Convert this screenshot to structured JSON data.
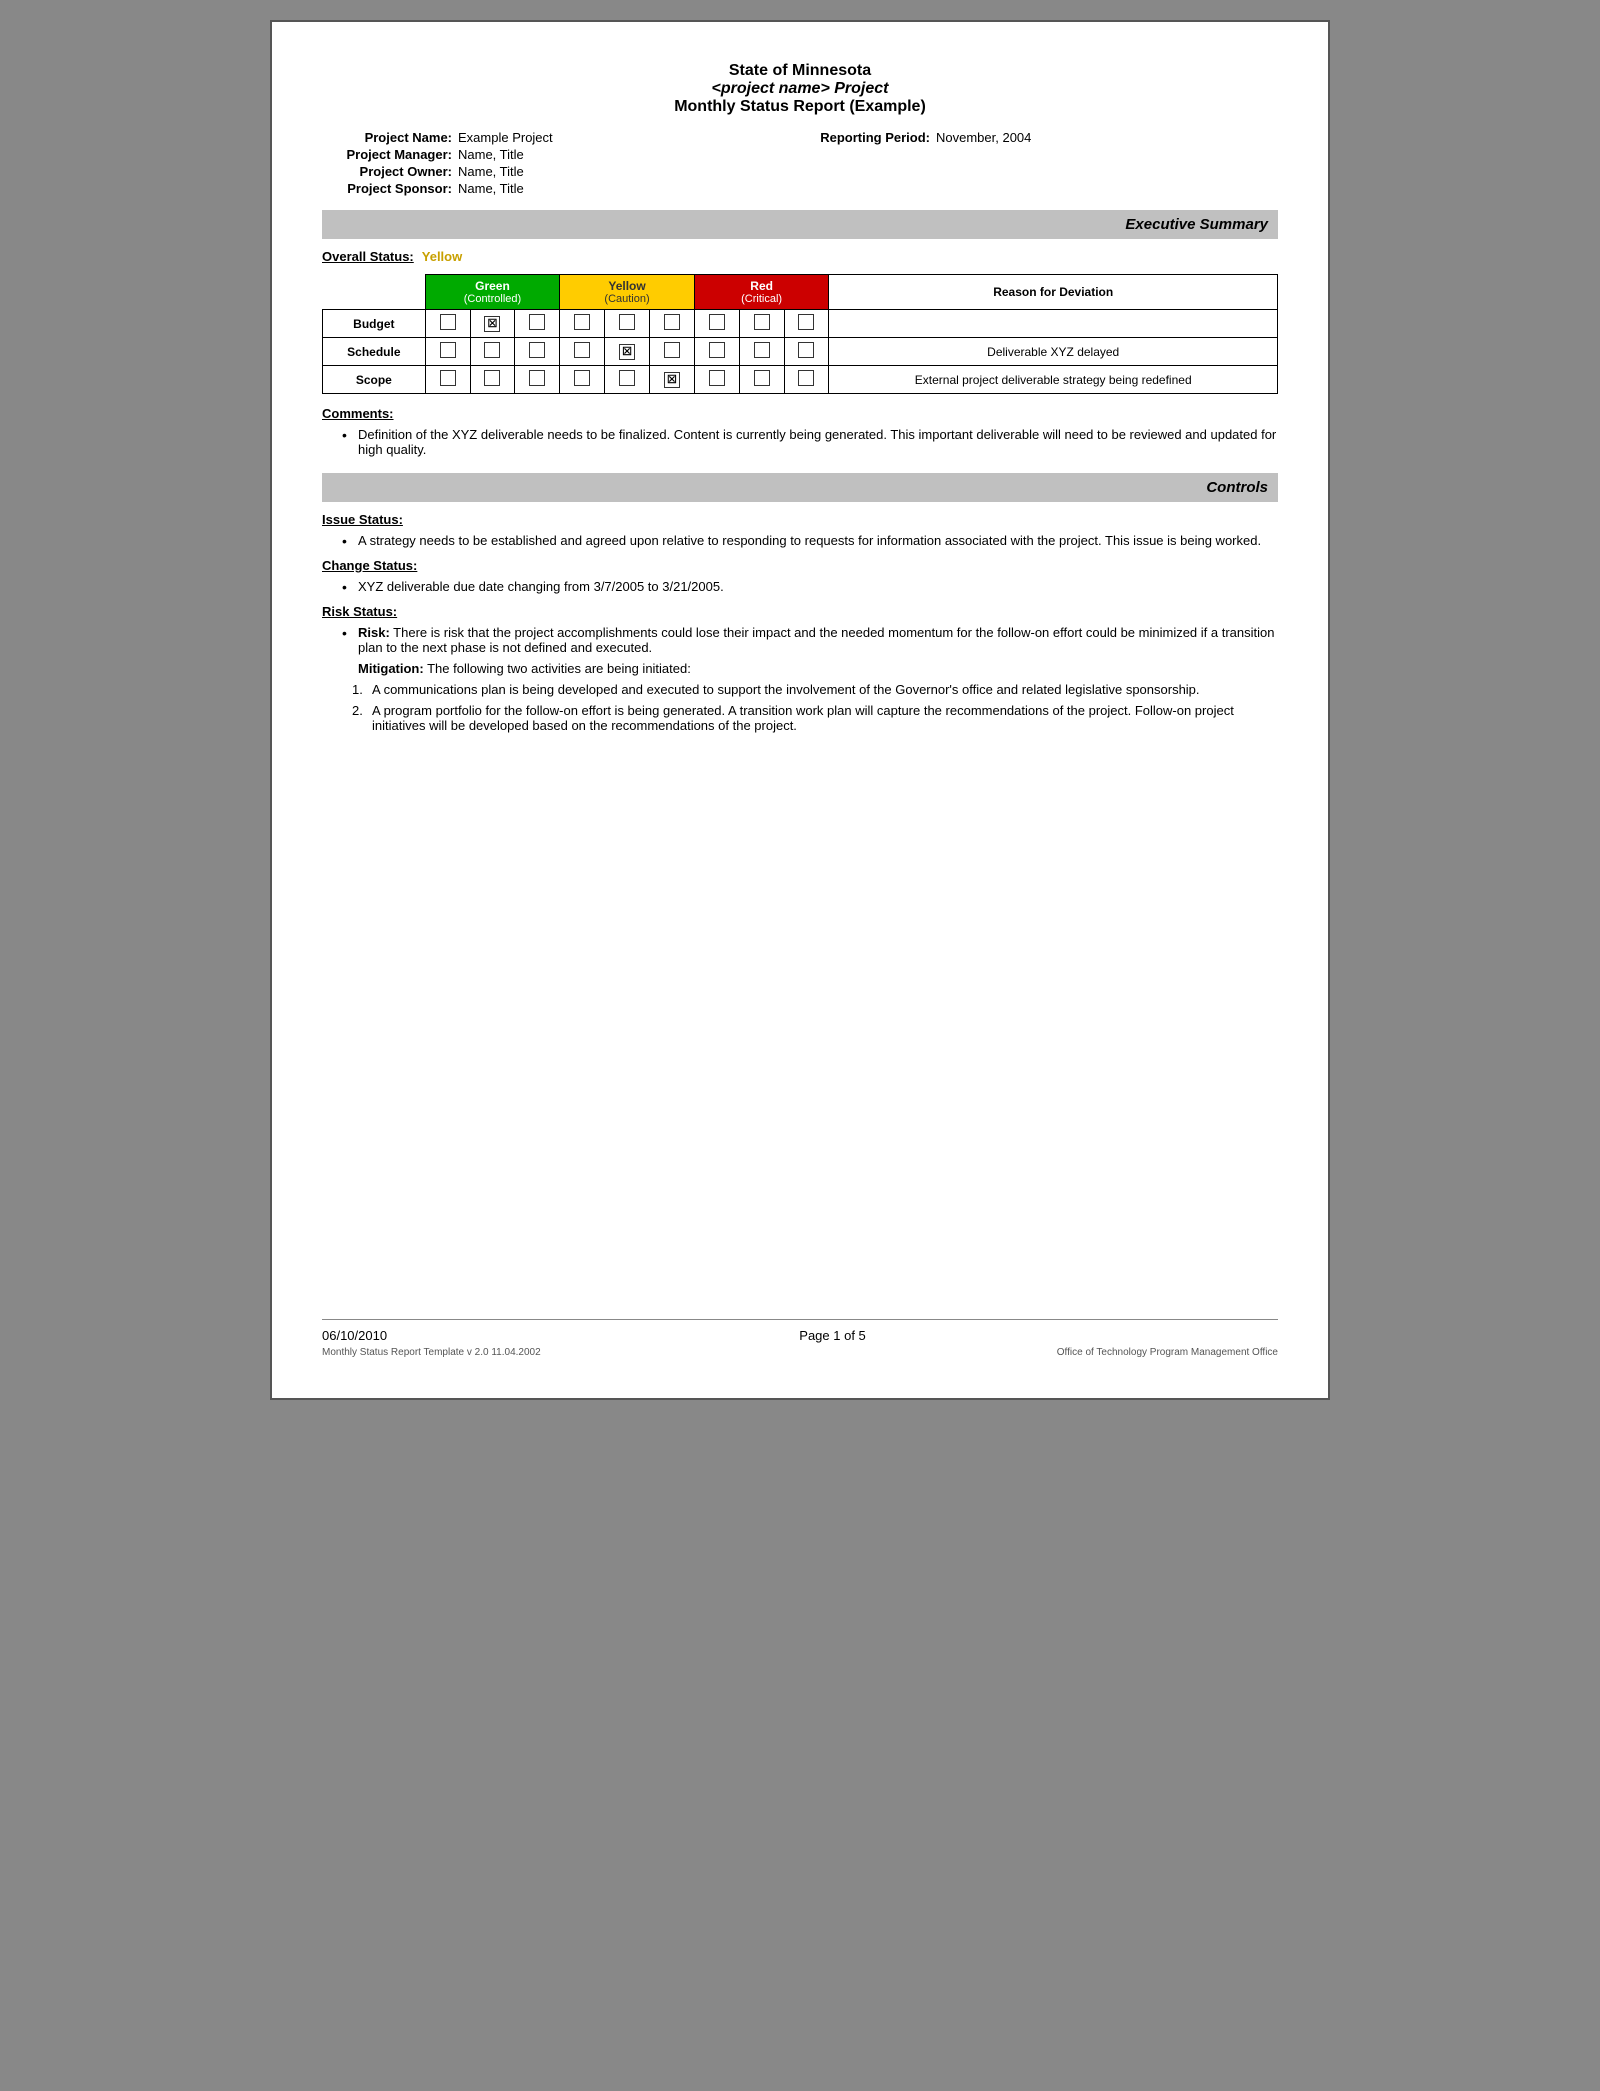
{
  "header": {
    "line1": "State of Minnesota",
    "line2": "<project name> Project",
    "line3": "Monthly Status Report (Example)"
  },
  "project_info": {
    "name_label": "Project Name:",
    "name_value": "Example Project",
    "reporting_period_label": "Reporting Period:",
    "reporting_period_value": "November, 2004",
    "manager_label": "Project Manager:",
    "manager_value": "Name, Title",
    "owner_label": "Project Owner:",
    "owner_value": "Name, Title",
    "sponsor_label": "Project Sponsor:",
    "sponsor_value": "Name, Title"
  },
  "executive_summary": {
    "header": "Executive Summary",
    "overall_status_label": "Overall Status:",
    "overall_status_value": "Yellow",
    "table": {
      "headers": {
        "green_label": "Green",
        "green_sub": "(Controlled)",
        "yellow_label": "Yellow",
        "yellow_sub": "(Caution)",
        "red_label": "Red",
        "red_sub": "(Critical)",
        "reason_label": "Reason for Deviation"
      },
      "rows": [
        {
          "label": "Budget",
          "green": [
            "",
            "X",
            ""
          ],
          "yellow": [
            "",
            "",
            ""
          ],
          "red": [
            "",
            "",
            ""
          ],
          "reason": ""
        },
        {
          "label": "Schedule",
          "green": [
            "",
            "",
            ""
          ],
          "yellow": [
            "",
            "X",
            ""
          ],
          "red": [
            "",
            "",
            ""
          ],
          "reason": "Deliverable XYZ delayed"
        },
        {
          "label": "Scope",
          "green": [
            "",
            "",
            ""
          ],
          "yellow": [
            "",
            "",
            "X"
          ],
          "red": [
            "",
            "",
            ""
          ],
          "reason": "External project deliverable strategy being redefined"
        }
      ]
    },
    "comments_label": "Comments:",
    "comments": [
      "Definition of the XYZ deliverable needs to be finalized.  Content is currently being generated.  This important deliverable will need to be reviewed and updated for high quality."
    ]
  },
  "controls": {
    "header": "Controls",
    "issue_status_label": "Issue Status:",
    "issue_status_items": [
      "A strategy needs to be established and agreed upon relative to responding to requests for information associated with the project.  This issue is being worked."
    ],
    "change_status_label": "Change Status:",
    "change_status_items": [
      "XYZ deliverable due date changing from 3/7/2005 to 3/21/2005."
    ],
    "risk_status_label": "Risk Status:",
    "risk_intro_bold": "Risk:",
    "risk_intro_text": " There is risk that the project accomplishments could lose their impact and the needed momentum for the follow-on effort could be minimized if a transition plan to the next phase is not defined and executed.",
    "mitigation_bold": "Mitigation:",
    "mitigation_text": " The following two activities are being initiated:",
    "mitigation_items": [
      "A communications plan is being developed and executed to support the involvement of the Governor's office and related legislative sponsorship.",
      "A program portfolio for the follow-on effort is being generated. A transition work plan will capture the recommendations of the project. Follow-on project initiatives will be developed based on the recommendations of the project."
    ]
  },
  "footer": {
    "date": "06/10/2010",
    "page_text": "Page 1 of 5",
    "template_text": "Monthly Status Report Template  v 2.0  11.04.2002",
    "office_text": "Office of Technology Program Management Office"
  }
}
